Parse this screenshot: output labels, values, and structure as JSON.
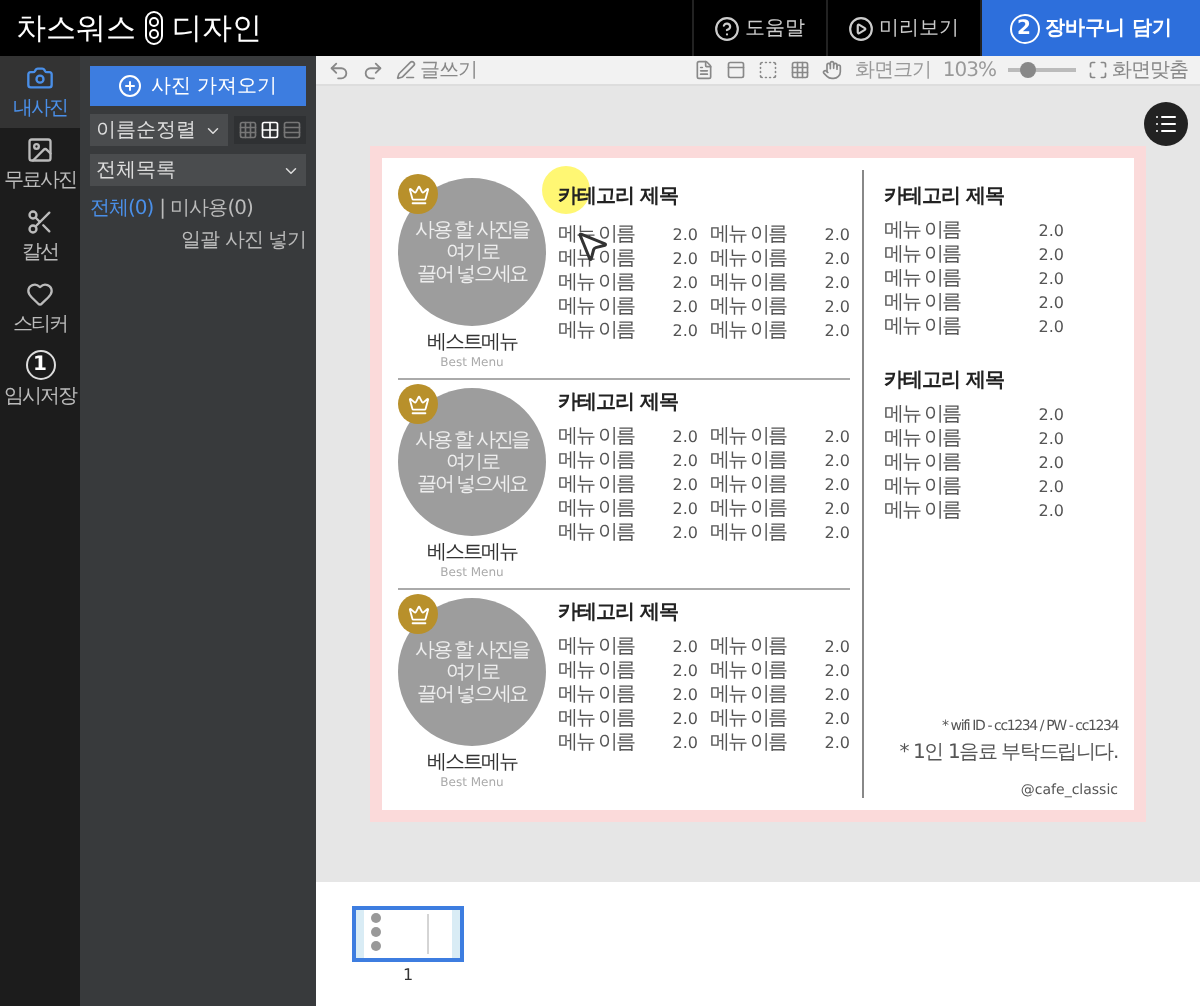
{
  "header": {
    "brand_left": "차스워스",
    "brand_right": "디자인",
    "actions": [
      {
        "kind": "help",
        "label": "도움말"
      },
      {
        "kind": "preview",
        "label": "미리보기"
      },
      {
        "kind": "cart",
        "step": "2",
        "label": "장바구니 담기"
      }
    ]
  },
  "sidebar": {
    "items": [
      {
        "kind": "photo",
        "label": "내사진",
        "selected": true
      },
      {
        "kind": "free",
        "label": "무료사진",
        "selected": false
      },
      {
        "kind": "cut",
        "label": "칼선",
        "selected": false
      },
      {
        "kind": "sticker",
        "label": "스티커",
        "selected": false
      },
      {
        "kind": "save",
        "badge": "1",
        "label": "임시저장",
        "selected": false
      }
    ]
  },
  "panel": {
    "import_button": "사진 가져오기",
    "sort": "이름순정렬",
    "views": [
      {
        "kind": "small",
        "selected": false
      },
      {
        "kind": "grid",
        "selected": true
      },
      {
        "kind": "list",
        "selected": false
      }
    ],
    "filter": "전체목록",
    "tabs": [
      {
        "label": "전체(0)",
        "selected": true
      },
      {
        "label": "| 미사용(0)",
        "selected": false
      }
    ],
    "bulk_link": "일괄 사진 넣기"
  },
  "toolbar": {
    "history": [
      {
        "kind": "undo"
      },
      {
        "kind": "redo"
      }
    ],
    "write": "글쓰기",
    "tools": [
      {
        "kind": "page"
      },
      {
        "kind": "label"
      },
      {
        "kind": "frame"
      },
      {
        "kind": "grid"
      },
      {
        "kind": "hand"
      }
    ],
    "zoom_label": "화면크기",
    "zoom_value": "103%",
    "zoom": {
      "level": 0.3
    },
    "fit": "화면맞춤"
  },
  "menu": {
    "sections": [
      {
        "photo_hint": [
          "사용 할 사진을",
          "여기로",
          "끌어 넣으세요"
        ],
        "best_ko": "베스트메뉴",
        "best_en": "Best Menu",
        "category": "카테고리 제목",
        "items": [
          {
            "name": "메뉴 이름",
            "price": "2.0"
          },
          {
            "name": "메뉴 이름",
            "price": "2.0"
          },
          {
            "name": "메뉴 이름",
            "price": "2.0"
          },
          {
            "name": "메뉴 이름",
            "price": "2.0"
          },
          {
            "name": "메뉴 이름",
            "price": "2.0"
          },
          {
            "name": "메뉴 이름",
            "price": "2.0"
          },
          {
            "name": "메뉴 이름",
            "price": "2.0"
          },
          {
            "name": "메뉴 이름",
            "price": "2.0"
          },
          {
            "name": "메뉴 이름",
            "price": "2.0"
          },
          {
            "name": "메뉴 이름",
            "price": "2.0"
          }
        ]
      },
      {
        "photo_hint": [
          "사용 할 사진을",
          "여기로",
          "끌어 넣으세요"
        ],
        "best_ko": "베스트메뉴",
        "best_en": "Best Menu",
        "category": "카테고리 제목",
        "items": [
          {
            "name": "메뉴 이름",
            "price": "2.0"
          },
          {
            "name": "메뉴 이름",
            "price": "2.0"
          },
          {
            "name": "메뉴 이름",
            "price": "2.0"
          },
          {
            "name": "메뉴 이름",
            "price": "2.0"
          },
          {
            "name": "메뉴 이름",
            "price": "2.0"
          },
          {
            "name": "메뉴 이름",
            "price": "2.0"
          },
          {
            "name": "메뉴 이름",
            "price": "2.0"
          },
          {
            "name": "메뉴 이름",
            "price": "2.0"
          },
          {
            "name": "메뉴 이름",
            "price": "2.0"
          },
          {
            "name": "메뉴 이름",
            "price": "2.0"
          }
        ]
      },
      {
        "photo_hint": [
          "사용 할 사진을",
          "여기로",
          "끌어 넣으세요"
        ],
        "best_ko": "베스트메뉴",
        "best_en": "Best Menu",
        "category": "카테고리 제목",
        "items": [
          {
            "name": "메뉴 이름",
            "price": "2.0"
          },
          {
            "name": "메뉴 이름",
            "price": "2.0"
          },
          {
            "name": "메뉴 이름",
            "price": "2.0"
          },
          {
            "name": "메뉴 이름",
            "price": "2.0"
          },
          {
            "name": "메뉴 이름",
            "price": "2.0"
          },
          {
            "name": "메뉴 이름",
            "price": "2.0"
          },
          {
            "name": "메뉴 이름",
            "price": "2.0"
          },
          {
            "name": "메뉴 이름",
            "price": "2.0"
          },
          {
            "name": "메뉴 이름",
            "price": "2.0"
          },
          {
            "name": "메뉴 이름",
            "price": "2.0"
          }
        ]
      }
    ],
    "side_sections": [
      {
        "category": "카테고리 제목",
        "items": [
          {
            "name": "메뉴 이름",
            "price": "2.0"
          },
          {
            "name": "메뉴 이름",
            "price": "2.0"
          },
          {
            "name": "메뉴 이름",
            "price": "2.0"
          },
          {
            "name": "메뉴 이름",
            "price": "2.0"
          },
          {
            "name": "메뉴 이름",
            "price": "2.0"
          }
        ]
      },
      {
        "category": "카테고리 제목",
        "items": [
          {
            "name": "메뉴 이름",
            "price": "2.0"
          },
          {
            "name": "메뉴 이름",
            "price": "2.0"
          },
          {
            "name": "메뉴 이름",
            "price": "2.0"
          },
          {
            "name": "메뉴 이름",
            "price": "2.0"
          },
          {
            "name": "메뉴 이름",
            "price": "2.0"
          }
        ]
      }
    ],
    "notes": [
      "* wifi ID - cc1234 / PW - cc1234",
      "* 1인 1음료 부탁드립니다."
    ],
    "handle": "@cafe_classic"
  },
  "pages": [
    {
      "number": "1",
      "selected": true
    }
  ]
}
